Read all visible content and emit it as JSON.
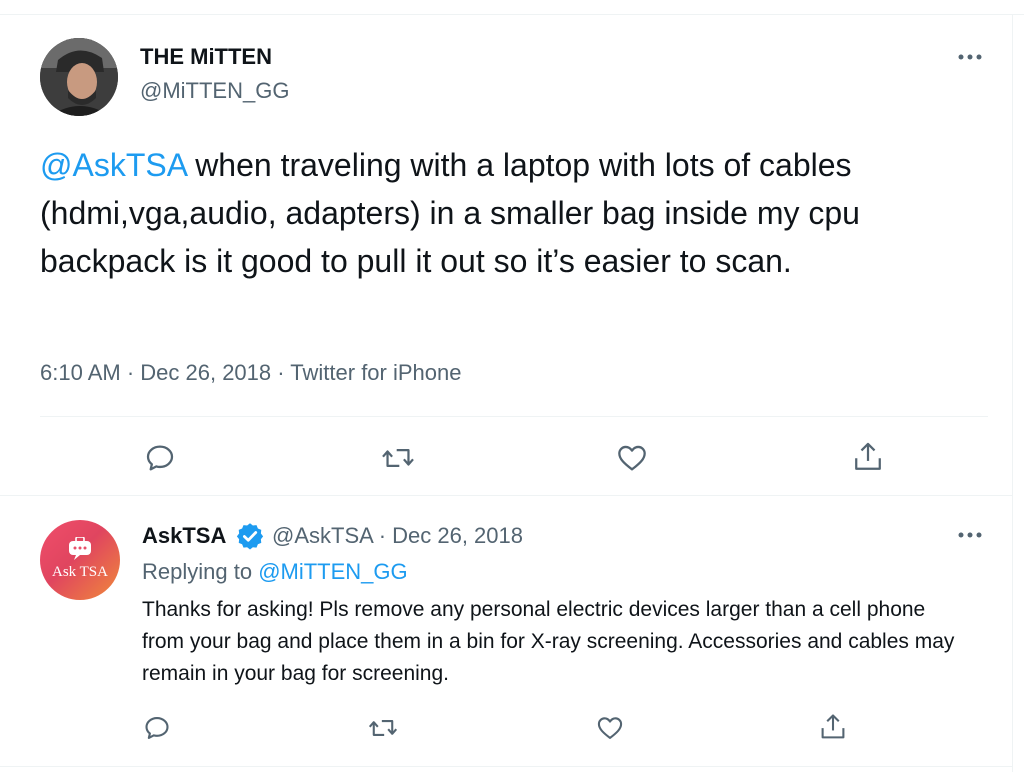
{
  "tweet": {
    "display_name": "THE MiTTEN",
    "handle": "@MiTTEN_GG",
    "mention": "@AskTSA",
    "text": " when traveling with a laptop with lots of cables (hdmi,vga,audio, adapters) in a smaller bag inside my cpu backpack is it good to pull it out so it’s easier to scan.",
    "timestamp": "6:10 AM · Dec 26, 2018 · Twitter for iPhone",
    "actions": [
      "reply-icon",
      "retweet-icon",
      "like-icon",
      "share-icon"
    ]
  },
  "reply": {
    "display_name": "AskTSA",
    "handle_date": "@AskTSA · Dec 26, 2018",
    "avatar_label": "Ask TSA",
    "replying_prefix": "Replying to ",
    "replying_to": "@MiTTEN_GG",
    "text": "Thanks for asking! Pls remove any personal electric devices larger than a cell phone from your bag and place them in a bin for X-ray screening. Accessories and cables may remain in your bag for screening.",
    "actions": [
      "reply-icon",
      "retweet-icon",
      "like-icon",
      "share-icon"
    ]
  },
  "colors": {
    "accent": "#1d9bf0",
    "muted": "#536471",
    "text": "#0f1419",
    "divider": "#eff3f4",
    "tsa_gradient_start": "#f04e6b",
    "tsa_gradient_end": "#f08a3a"
  }
}
